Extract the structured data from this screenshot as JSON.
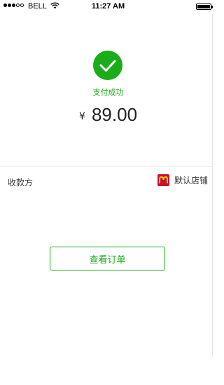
{
  "status_bar": {
    "carrier": "BELL",
    "time": "11:27 AM",
    "signal_bars_filled": 3,
    "signal_bars_total": 5,
    "battery_icon": "battery-full-icon",
    "wifi_icon": "wifi-icon"
  },
  "result": {
    "icon": "checkmark-circle-icon",
    "status_text": "支付成功",
    "currency_symbol": "¥",
    "amount": "89.00",
    "accent_color": "#1aad19"
  },
  "payee": {
    "label": "收款方",
    "merchant_logo_icon": "merchant-logo-icon",
    "merchant_name": "默认店铺"
  },
  "actions": {
    "view_order_label": "查看订单"
  }
}
